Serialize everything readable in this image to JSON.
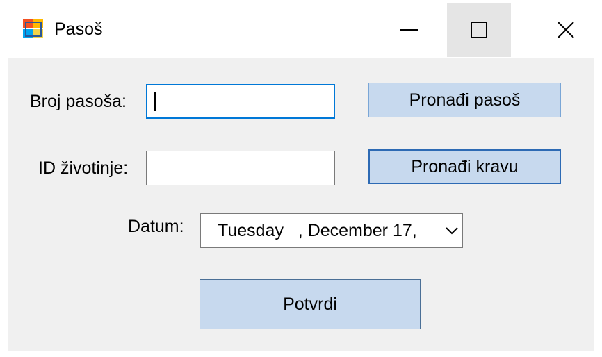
{
  "window": {
    "title": "Pasoš"
  },
  "form": {
    "passport_label": "Broj pasoša:",
    "passport_value": "",
    "find_passport_label": "Pronađi pasoš",
    "animal_id_label": "ID životinje:",
    "animal_id_value": "",
    "find_cow_label": "Pronađi kravu",
    "date_label": "Datum:",
    "date_value": "Tuesday   , December 17,",
    "confirm_label": "Potvrdi"
  },
  "colors": {
    "accent": "#0078d7",
    "button_fill": "#c7d9ee",
    "client_bg": "#f0f0f0"
  },
  "icons": {
    "app": "windows-form-icon",
    "minimize": "minimize-icon",
    "maximize": "maximize-icon",
    "close": "close-icon",
    "dropdown": "chevron-down-icon"
  }
}
